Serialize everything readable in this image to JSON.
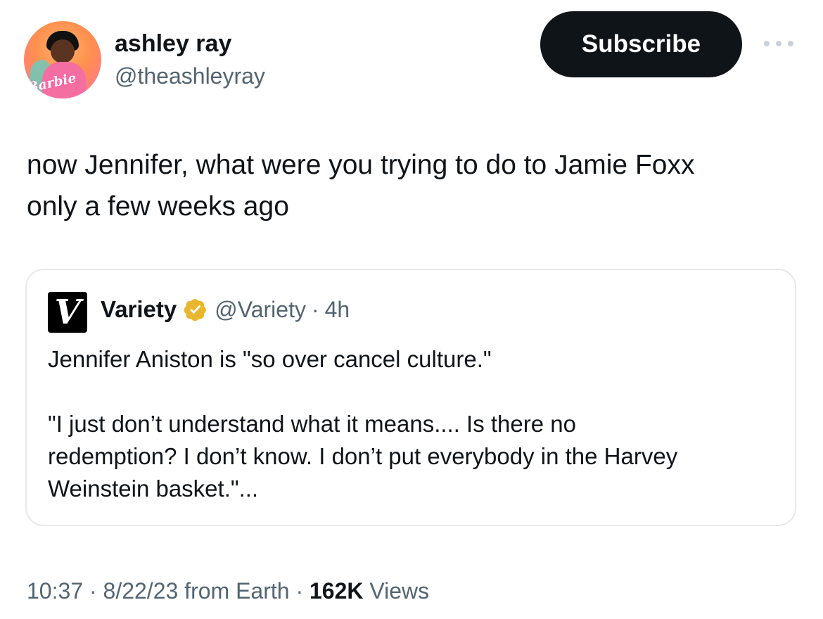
{
  "author": {
    "name": "ashley ray",
    "handle": "@theashleyray",
    "avatar_badge_text": "Barbie"
  },
  "header": {
    "subscribe_label": "Subscribe",
    "more_icon": "more-horizontal-icon"
  },
  "tweet": {
    "text": "now Jennifer, what were you trying to do to Jamie Foxx\nonly a few weeks ago"
  },
  "quote": {
    "logo_letter": "V",
    "name": "Variety",
    "verified_icon": "verified-badge-icon",
    "handle": "@Variety",
    "separator": "·",
    "time": "4h",
    "text": "Jennifer Aniston is \"so over cancel culture.\"\n\n\"I just don’t understand what it means.... Is there no\nredemption? I don’t know. I don’t put everybody in the Harvey\nWeinstein basket.\"..."
  },
  "footer": {
    "time": "10:37",
    "separator1": "·",
    "date": "8/22/23",
    "source": "from Earth",
    "separator2": "·",
    "views_count": "162K",
    "views_label": "Views"
  },
  "colors": {
    "text_primary": "#0f1419",
    "text_secondary": "#536471",
    "border": "#e7e9ea",
    "verified_gold": "#e8b730"
  }
}
